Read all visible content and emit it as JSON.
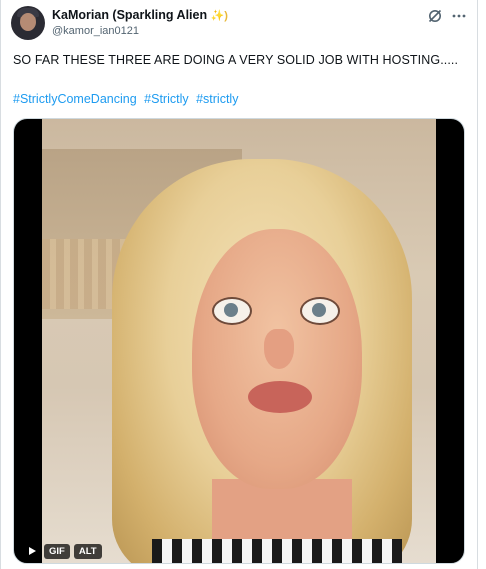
{
  "post": {
    "display_name": "KaMorian (Sparkling Alien",
    "display_name_emoji": "✨)",
    "handle": "@kamor_ian0121",
    "text": "SO FAR THESE THREE ARE DOING A VERY SOLID JOB WITH HOSTING.....",
    "hashtags": [
      "#StrictlyComeDancing",
      "#Strictly",
      "#strictly"
    ],
    "icons": [
      "grok-icon",
      "more-icon"
    ],
    "colors": {
      "link": "#1d9bf0",
      "text": "#0f1419",
      "muted": "#536471"
    }
  },
  "media": {
    "gif_badge": "GIF",
    "alt_badge": "ALT",
    "icons": [
      "play-icon"
    ]
  }
}
